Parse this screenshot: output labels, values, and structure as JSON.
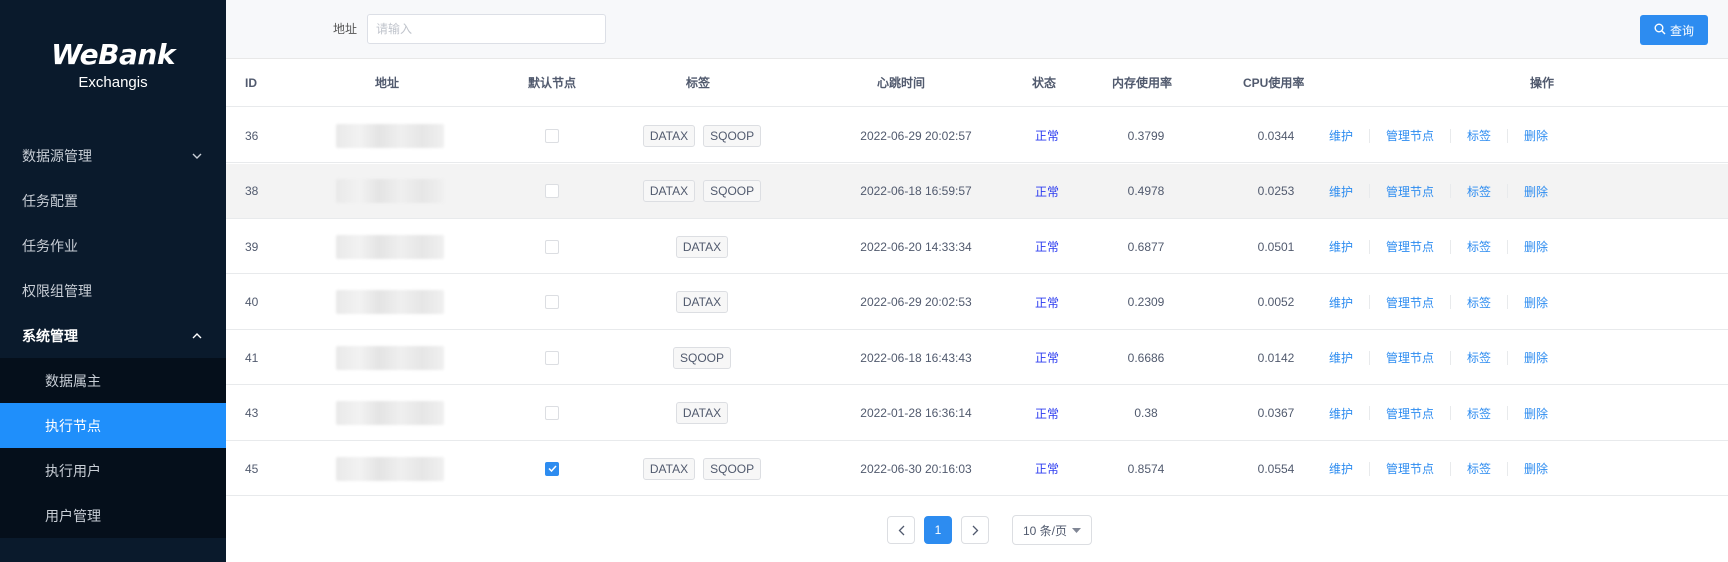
{
  "brand": {
    "name": "WeBank",
    "product": "Exchangis"
  },
  "sidebar": {
    "items": [
      {
        "label": "数据源管理",
        "chevron": "down"
      },
      {
        "label": "任务配置"
      },
      {
        "label": "任务作业"
      },
      {
        "label": "权限组管理"
      },
      {
        "label": "系统管理",
        "chevron": "up",
        "expanded": true
      }
    ],
    "submenu": [
      {
        "label": "数据属主"
      },
      {
        "label": "执行节点",
        "active": true
      },
      {
        "label": "执行用户"
      },
      {
        "label": "用户管理"
      }
    ]
  },
  "search": {
    "label": "地址",
    "placeholder": "请输入",
    "value": "",
    "button_label": "查询",
    "button_icon": "search-icon"
  },
  "table": {
    "headers": {
      "id": "ID",
      "address": "地址",
      "default_node": "默认节点",
      "tags": "标签",
      "heartbeat": "心跳时间",
      "status": "状态",
      "memory": "内存使用率",
      "cpu": "CPU使用率",
      "actions": "操作"
    },
    "action_labels": [
      "维护",
      "管理节点",
      "标签",
      "删除"
    ],
    "rows": [
      {
        "id": "36",
        "default": false,
        "tags": [
          "DATAX",
          "SQOOP"
        ],
        "heartbeat": "2022-06-29 20:02:57",
        "status": "正常",
        "memory": "0.3799",
        "cpu": "0.0344"
      },
      {
        "id": "38",
        "default": false,
        "tags": [
          "DATAX",
          "SQOOP"
        ],
        "heartbeat": "2022-06-18 16:59:57",
        "status": "正常",
        "memory": "0.4978",
        "cpu": "0.0253",
        "highlighted": true
      },
      {
        "id": "39",
        "default": false,
        "tags": [
          "DATAX"
        ],
        "heartbeat": "2022-06-20 14:33:34",
        "status": "正常",
        "memory": "0.6877",
        "cpu": "0.0501"
      },
      {
        "id": "40",
        "default": false,
        "tags": [
          "DATAX"
        ],
        "heartbeat": "2022-06-29 20:02:53",
        "status": "正常",
        "memory": "0.2309",
        "cpu": "0.0052"
      },
      {
        "id": "41",
        "default": false,
        "tags": [
          "SQOOP"
        ],
        "heartbeat": "2022-06-18 16:43:43",
        "status": "正常",
        "memory": "0.6686",
        "cpu": "0.0142"
      },
      {
        "id": "43",
        "default": false,
        "tags": [
          "DATAX"
        ],
        "heartbeat": "2022-01-28 16:36:14",
        "status": "正常",
        "memory": "0.38",
        "cpu": "0.0367"
      },
      {
        "id": "45",
        "default": true,
        "tags": [
          "DATAX",
          "SQOOP"
        ],
        "heartbeat": "2022-06-30 20:16:03",
        "status": "正常",
        "memory": "0.8574",
        "cpu": "0.0554"
      }
    ]
  },
  "pagination": {
    "current_page": "1",
    "page_size_label": "10 条/页"
  },
  "colors": {
    "sidebar_bg": "#0a1a2c",
    "accent": "#2d8cf0",
    "status_ok": "#2d3cf0"
  }
}
